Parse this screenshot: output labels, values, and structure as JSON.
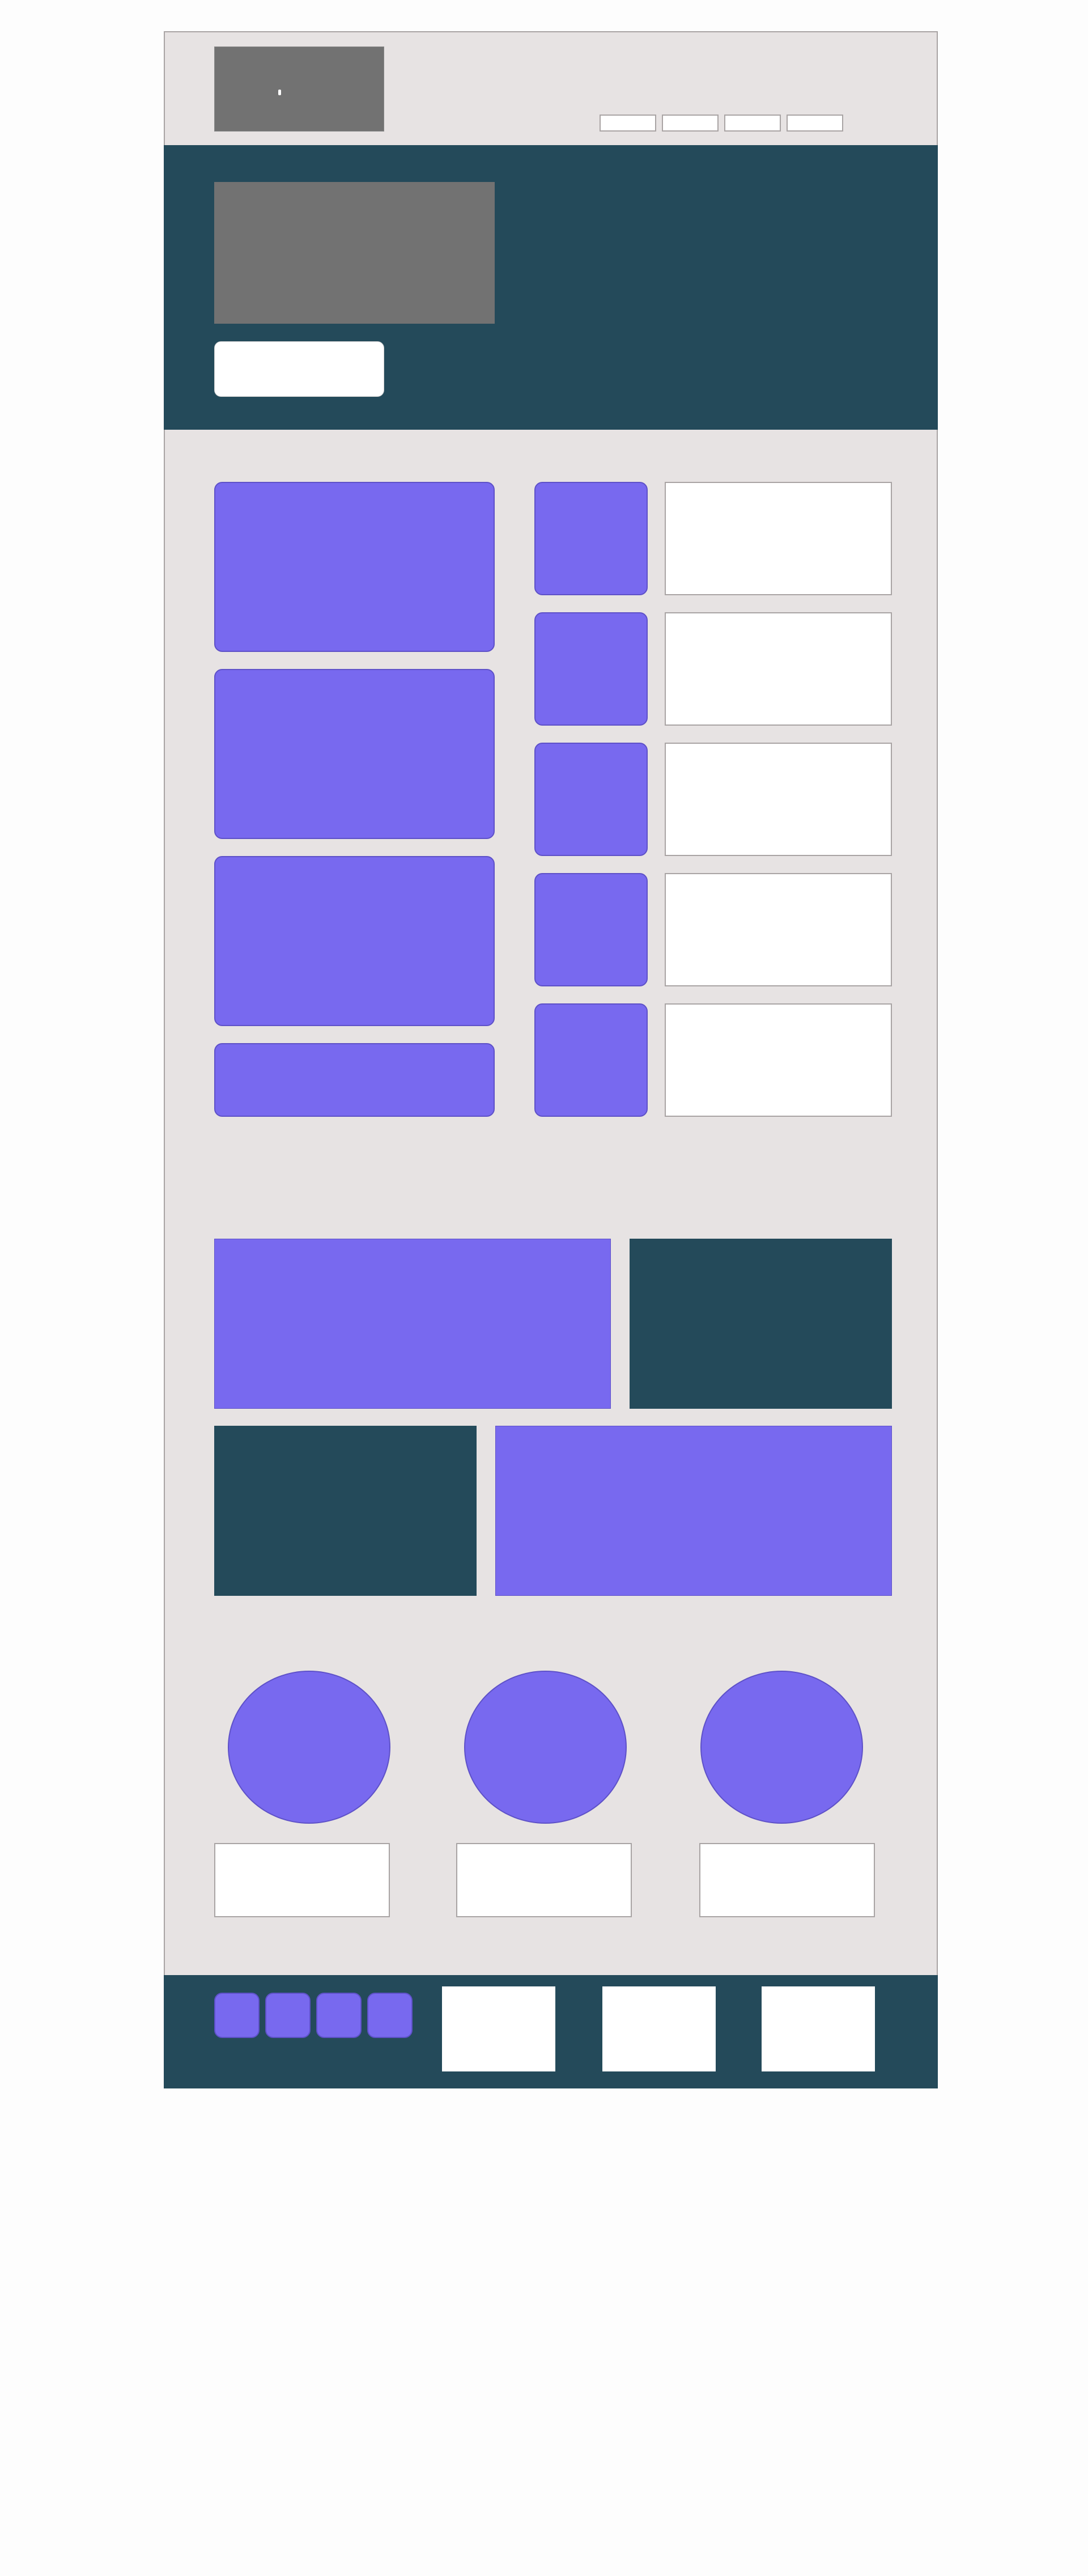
{
  "page": {
    "background": "#fdfdfd",
    "frame_background": "#e7e3e3"
  },
  "colors": {
    "accent_purple": "#7869ef",
    "dark_teal": "#244a5a",
    "placeholder_gray": "#727272",
    "border_gray": "#a9a4a4"
  },
  "header": {
    "logo_icon": "image-placeholder-icon",
    "nav_items": [
      "",
      "",
      "",
      ""
    ]
  },
  "hero": {
    "media_icon": "image-placeholder-icon",
    "button_label": ""
  },
  "features": {
    "cards": [
      "",
      "",
      "",
      ""
    ],
    "list": [
      "",
      "",
      "",
      "",
      ""
    ]
  },
  "blocks": [
    "",
    "",
    "",
    ""
  ],
  "team": {
    "captions": [
      "",
      "",
      ""
    ]
  },
  "footer": {
    "social_icons": [
      "social-icon-1",
      "social-icon-2",
      "social-icon-3",
      "social-icon-4"
    ],
    "columns": [
      "",
      "",
      ""
    ]
  }
}
